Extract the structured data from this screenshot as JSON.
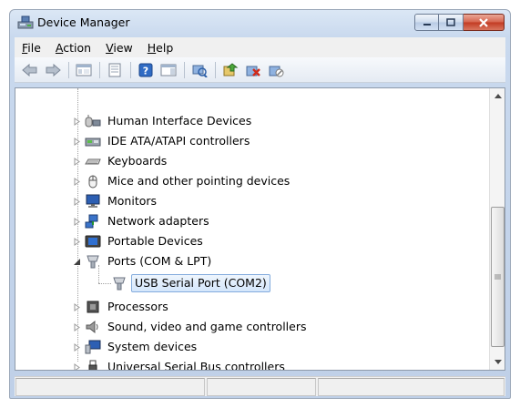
{
  "window": {
    "title": "Device Manager"
  },
  "menu": [
    {
      "mnemonic": "F",
      "rest": "ile"
    },
    {
      "mnemonic": "A",
      "rest": "ction"
    },
    {
      "mnemonic": "V",
      "rest": "iew"
    },
    {
      "mnemonic": "H",
      "rest": "elp"
    }
  ],
  "toolbar": {
    "buttons": [
      "back-icon",
      "forward-icon",
      "show-hide-console-tree-icon",
      "properties-icon",
      "help-icon",
      "action-pane-icon",
      "scan-hardware-changes-icon",
      "update-driver-icon",
      "uninstall-icon",
      "disable-icon"
    ]
  },
  "tree": {
    "items": [
      {
        "label": "Human Interface Devices",
        "icon": "hid-icon",
        "expanded": false
      },
      {
        "label": "IDE ATA/ATAPI controllers",
        "icon": "ide-controller-icon",
        "expanded": false
      },
      {
        "label": "Keyboards",
        "icon": "keyboard-icon",
        "expanded": false
      },
      {
        "label": "Mice and other pointing devices",
        "icon": "mouse-icon",
        "expanded": false
      },
      {
        "label": "Monitors",
        "icon": "monitor-icon",
        "expanded": false
      },
      {
        "label": "Network adapters",
        "icon": "network-adapter-icon",
        "expanded": false
      },
      {
        "label": "Portable Devices",
        "icon": "portable-device-icon",
        "expanded": false
      },
      {
        "label": "Ports (COM & LPT)",
        "icon": "port-icon",
        "expanded": true
      },
      {
        "label": "USB Serial Port (COM2)",
        "icon": "port-icon",
        "child": true,
        "selected": true
      },
      {
        "label": "Processors",
        "icon": "processor-icon",
        "expanded": false
      },
      {
        "label": "Sound, video and game controllers",
        "icon": "speaker-icon",
        "expanded": false
      },
      {
        "label": "System devices",
        "icon": "system-device-icon",
        "expanded": false
      },
      {
        "label": "Universal Serial Bus controllers",
        "icon": "usb-icon",
        "expanded": false
      }
    ]
  },
  "colors": {
    "accent_selection": "#84acdd",
    "titlebar": "#dbe7f5",
    "close_button": "#c23a22"
  }
}
